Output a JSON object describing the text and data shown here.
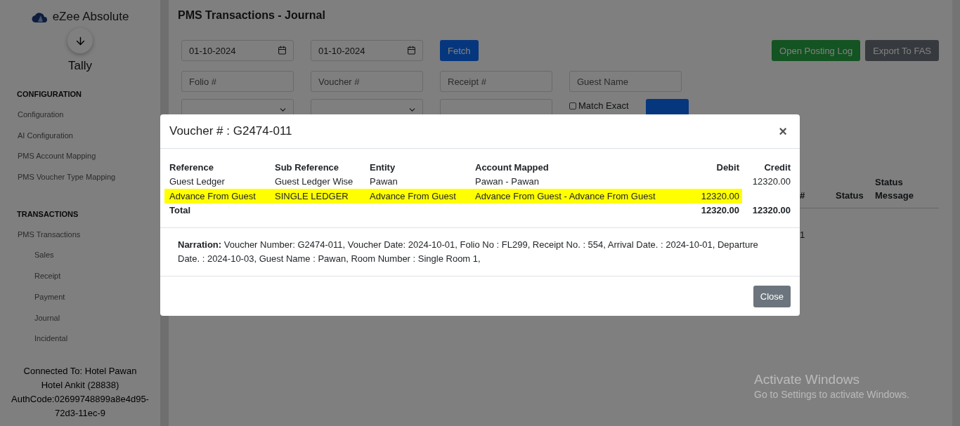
{
  "sidebar": {
    "brand": "eZee Absolute",
    "app_name": "Tally",
    "sections": [
      {
        "heading": "CONFIGURATION",
        "items": [
          {
            "label": "Configuration"
          },
          {
            "label": "AI Configuration"
          },
          {
            "label": "PMS Account Mapping"
          },
          {
            "label": "PMS Voucher Type Mapping"
          }
        ]
      },
      {
        "heading": "TRANSACTIONS",
        "items": [
          {
            "label": "PMS Transactions",
            "children": [
              {
                "label": "Sales"
              },
              {
                "label": "Receipt"
              },
              {
                "label": "Payment"
              },
              {
                "label": "Journal"
              },
              {
                "label": "Incidental"
              }
            ]
          }
        ]
      }
    ],
    "connection": [
      "Connected To: Hotel Pawan",
      "Hotel Ankit (28838)",
      "AuthCode:02699748899a8e4d95-72d3-11ec-9"
    ]
  },
  "page": {
    "title": "PMS Transactions - Journal",
    "from_date": "01-10-2024",
    "to_date": "01-10-2024",
    "fetch_button": "Fetch",
    "log_button": "Open Posting Log",
    "export_button": "Export To FAS",
    "filters": [
      {
        "placeholder": "Folio #"
      },
      {
        "placeholder": "Voucher #"
      },
      {
        "placeholder": "Receipt #"
      },
      {
        "placeholder": "Guest Name"
      }
    ],
    "match_exact": {
      "label": "Match Exact",
      "checked": false
    },
    "table": {
      "columns": [
        "#",
        "Status",
        "Status Message"
      ],
      "rows": [
        [
          "1",
          "",
          ""
        ]
      ]
    }
  },
  "modal": {
    "title": "Voucher # : G2474-011",
    "close_icon": "×",
    "columns": [
      "Reference",
      "Sub Reference",
      "Entity",
      "Account Mapped",
      "Debit",
      "Credit"
    ],
    "rows": [
      {
        "cells": [
          "Guest Ledger",
          "Guest Ledger Wise",
          "Pawan",
          "Pawan - Pawan",
          "",
          "12320.00"
        ],
        "highlighted": false
      },
      {
        "cells": [
          "Advance From Guest",
          "SINGLE LEDGER",
          "Advance From Guest",
          "Advance From Guest - Advance From Guest",
          "12320.00",
          ""
        ],
        "highlighted": true
      }
    ],
    "total": {
      "label": "Total",
      "debit": "12320.00",
      "credit": "12320.00"
    },
    "narration": "**Narration:** Voucher Number: G2474-011, Voucher Date: 2024-10-01, Folio No : FL299, Receipt No. : 554, Arrival Date. : 2024-10-01, Departure Date. : 2024-10-03, Guest Name : Pawan, Room Number : Single Room 1,",
    "close_button": "Close"
  },
  "os_notice": {
    "title": "Activate Windows",
    "text": "Go to Settings to activate Windows."
  }
}
